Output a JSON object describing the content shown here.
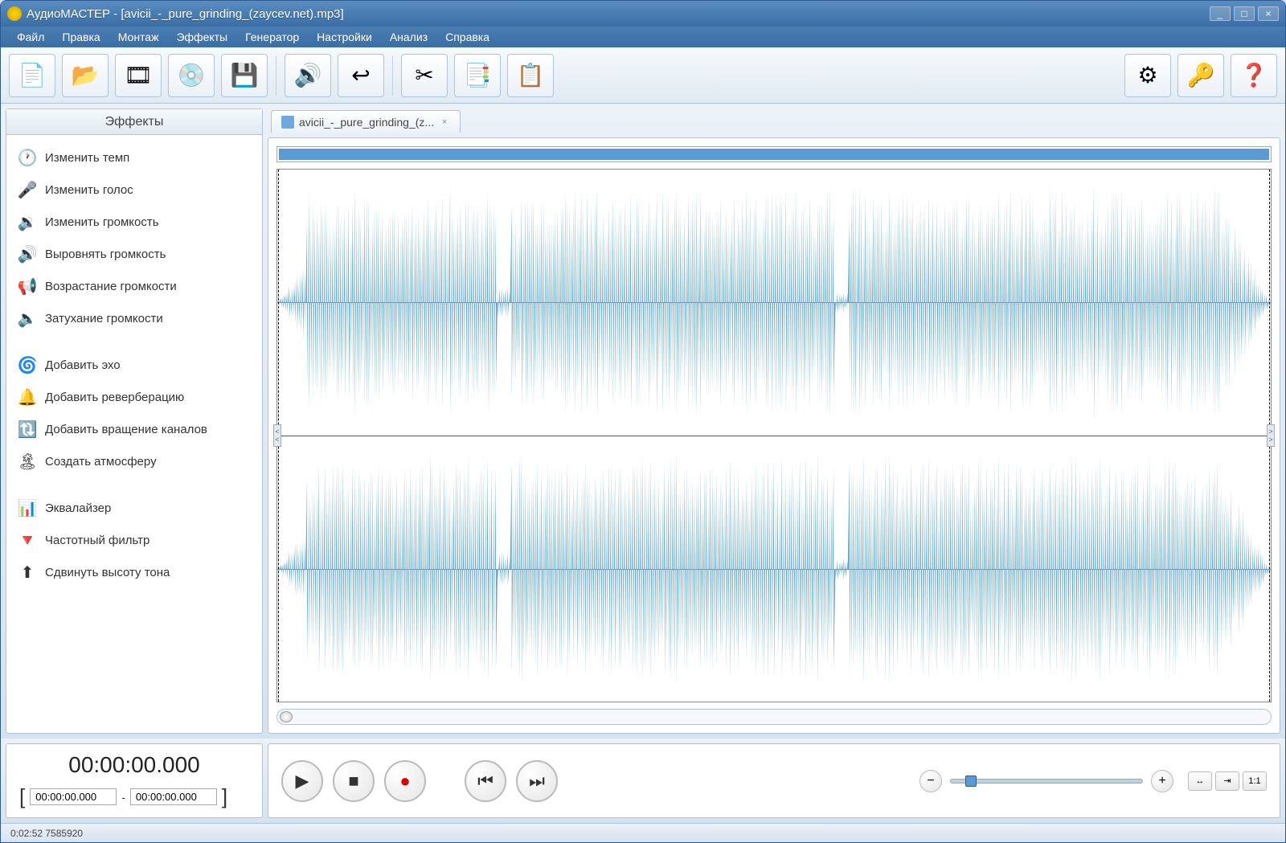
{
  "window": {
    "title": "АудиоМАСТЕР - [avicii_-_pure_grinding_(zaycev.net).mp3]"
  },
  "menu": {
    "items": [
      "Файл",
      "Правка",
      "Монтаж",
      "Эффекты",
      "Генератор",
      "Настройки",
      "Анализ",
      "Справка"
    ]
  },
  "toolbar": {
    "buttons": [
      {
        "name": "new-file-button",
        "icon": "📄"
      },
      {
        "name": "open-file-button",
        "icon": "📂"
      },
      {
        "name": "open-video-button",
        "icon": "🎞"
      },
      {
        "name": "rip-cd-button",
        "icon": "💿"
      },
      {
        "name": "save-button",
        "icon": "💾"
      },
      {
        "sep": true
      },
      {
        "name": "record-audio-button",
        "icon": "🔊"
      },
      {
        "name": "undo-button",
        "icon": "↩"
      },
      {
        "sep": true
      },
      {
        "name": "cut-button",
        "icon": "✂"
      },
      {
        "name": "copy-button",
        "icon": "📑"
      },
      {
        "name": "paste-button",
        "icon": "📋"
      }
    ],
    "right": [
      {
        "name": "settings-button",
        "icon": "⚙"
      },
      {
        "name": "register-button",
        "icon": "🔑"
      },
      {
        "name": "help-button",
        "icon": "❓"
      }
    ]
  },
  "sidebar": {
    "title": "Эффекты",
    "groups": [
      [
        {
          "name": "effect-tempo",
          "label": "Изменить темп",
          "icon": "🕐"
        },
        {
          "name": "effect-voice",
          "label": "Изменить голос",
          "icon": "🎤"
        },
        {
          "name": "effect-volume",
          "label": "Изменить громкость",
          "icon": "🔉"
        },
        {
          "name": "effect-normalize",
          "label": "Выровнять громкость",
          "icon": "🔊"
        },
        {
          "name": "effect-fadein",
          "label": "Возрастание громкости",
          "icon": "📢"
        },
        {
          "name": "effect-fadeout",
          "label": "Затухание громкости",
          "icon": "🔈"
        }
      ],
      [
        {
          "name": "effect-echo",
          "label": "Добавить эхо",
          "icon": "🌀"
        },
        {
          "name": "effect-reverb",
          "label": "Добавить реверберацию",
          "icon": "🔔"
        },
        {
          "name": "effect-channel-rotate",
          "label": "Добавить вращение каналов",
          "icon": "🔃"
        },
        {
          "name": "effect-atmosphere",
          "label": "Создать атмосферу",
          "icon": "🏝"
        }
      ],
      [
        {
          "name": "effect-equalizer",
          "label": "Эквалайзер",
          "icon": "📊"
        },
        {
          "name": "effect-freq-filter",
          "label": "Частотный фильтр",
          "icon": "🔻"
        },
        {
          "name": "effect-pitch",
          "label": "Сдвинуть высоту тона",
          "icon": "⬆"
        }
      ]
    ]
  },
  "tab": {
    "label": "avicii_-_pure_grinding_(z..."
  },
  "time": {
    "current": "00:00:00.000",
    "from": "00:00:00.000",
    "sep": "-",
    "to": "00:00:00.000"
  },
  "transport": {
    "play": "▶",
    "stop": "■",
    "record": "●",
    "prev": "⏮",
    "next": "⏭",
    "zoom_out": "−",
    "zoom_in": "+",
    "fit_h": "↔",
    "fit_sel": "⇥",
    "one_to_one": "1:1"
  },
  "status": {
    "text": "0:02:52 7585920"
  }
}
